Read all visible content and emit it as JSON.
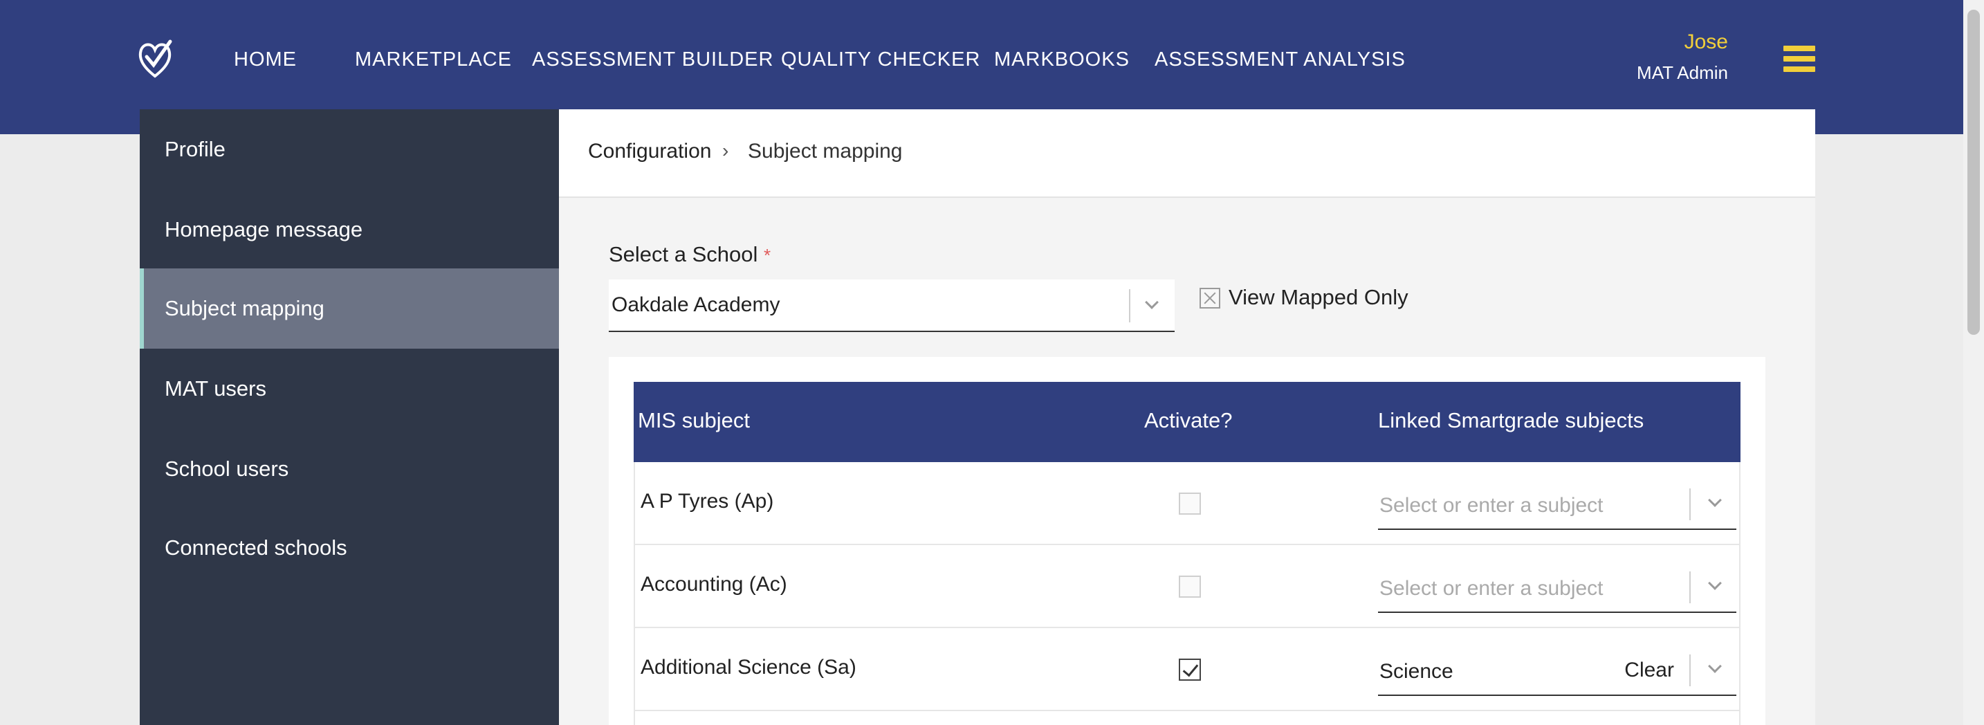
{
  "nav": {
    "logo_icon": "heart-check-logo-icon",
    "items": [
      "HOME",
      "MARKETPLACE",
      "ASSESSMENT BUILDER",
      "QUALITY CHECKER",
      "MARKBOOKS",
      "ASSESSMENT ANALYSIS"
    ]
  },
  "user": {
    "name": "Jose",
    "role": "MAT Admin"
  },
  "menu_icon": "hamburger-menu-icon",
  "sidebar": {
    "items": [
      {
        "label": "Profile"
      },
      {
        "label": "Homepage message"
      },
      {
        "label": "Subject mapping",
        "active": true
      },
      {
        "label": "MAT users"
      },
      {
        "label": "School users"
      },
      {
        "label": "Connected schools"
      }
    ]
  },
  "breadcrumb": {
    "parent": "Configuration",
    "separator": "›",
    "current": "Subject mapping"
  },
  "form": {
    "school_label": "Select a School",
    "required_mark": "*",
    "school_value": "Oakdale Academy",
    "view_mapped_label": "View Mapped Only"
  },
  "table": {
    "headers": {
      "mis": "MIS subject",
      "activate": "Activate?",
      "linked": "Linked Smartgrade subjects"
    },
    "rows": [
      {
        "name": "A P Tyres (Ap)",
        "activated": false,
        "linked": "",
        "placeholder": "Select or enter a subject"
      },
      {
        "name": "Accounting (Ac)",
        "activated": false,
        "linked": "",
        "placeholder": "Select or enter a subject"
      },
      {
        "name": "Additional Science (Sa)",
        "activated": true,
        "linked": "Science",
        "clear_label": "Clear"
      }
    ]
  },
  "colors": {
    "topbar": "#303f7f",
    "accent": "#f2cf3a",
    "sidebar": "#2f3748",
    "sidebar_active": "#6c7385"
  }
}
